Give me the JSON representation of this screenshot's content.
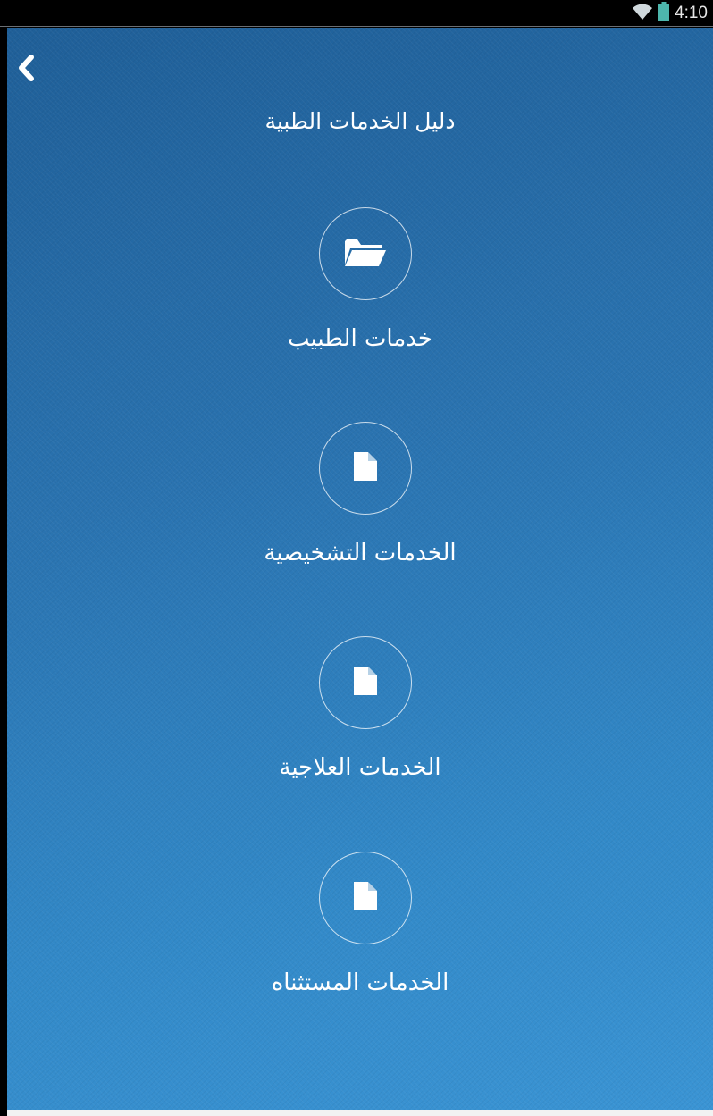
{
  "status_bar": {
    "time": "4:10",
    "icons": [
      "wifi-icon",
      "battery-icon"
    ]
  },
  "header": {
    "back_icon": "chevron-left-icon",
    "title": "دليل الخدمات الطبية"
  },
  "menu": {
    "items": [
      {
        "label": "خدمات الطبيب",
        "icon": "folder-open-icon"
      },
      {
        "label": "الخدمات التشخيصية",
        "icon": "file-icon"
      },
      {
        "label": "الخدمات العلاجية",
        "icon": "file-icon"
      },
      {
        "label": "الخدمات المستثناه",
        "icon": "file-icon"
      }
    ]
  },
  "colors": {
    "background": "#2e7ab8",
    "foreground": "#ffffff",
    "status_bar": "#000000"
  }
}
